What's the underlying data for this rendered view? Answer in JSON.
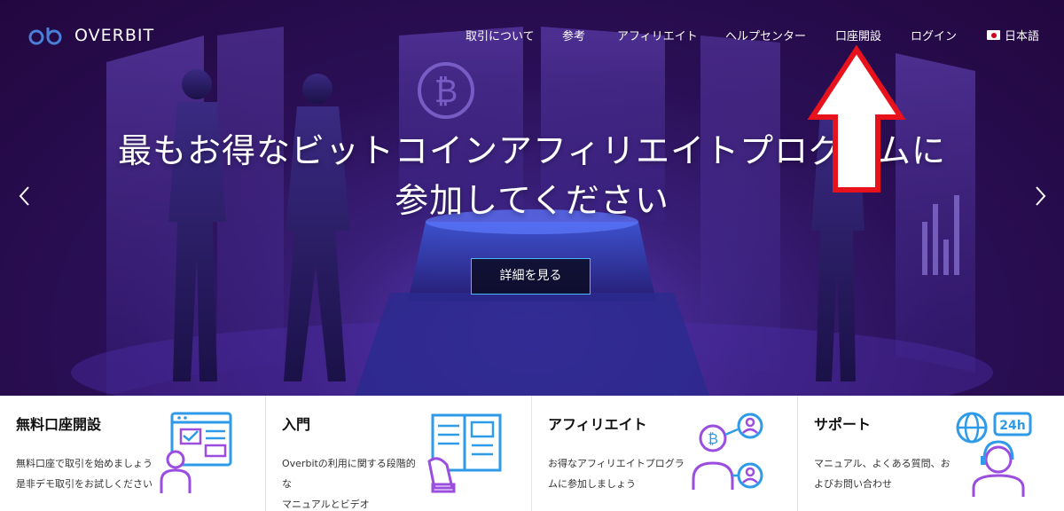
{
  "brand": {
    "name": "OVERBIT",
    "mark": "ob"
  },
  "nav": {
    "items": [
      "取引について",
      "参考",
      "アフィリエイト",
      "ヘルプセンター",
      "口座開設",
      "ログイン"
    ],
    "language": "日本語"
  },
  "hero": {
    "headline_line1": "最もお得なビットコインアフィリエイトプログラムに",
    "headline_line2": "参加してください",
    "cta_label": "詳細を見る"
  },
  "cards": [
    {
      "title": "無料口座開設",
      "desc_line1": "無料口座で取引を始めましょう",
      "desc_line2": "是非デモ取引をお試しください",
      "icon": "account-signup-icon"
    },
    {
      "title": "入門",
      "desc_line1": "Overbitの利用に関する段階的な",
      "desc_line2": "マニュアルとビデオ",
      "icon": "manual-book-icon"
    },
    {
      "title": "アフィリエイト",
      "desc_line1": "お得なアフィリエイトプログラ",
      "desc_line2": "ムに参加しましょう",
      "icon": "affiliate-network-icon"
    },
    {
      "title": "サポート",
      "desc_line1": "マニュアル、よくある質問、お",
      "desc_line2": "よびお問い合わせ",
      "icon": "support-24h-icon"
    }
  ],
  "colors": {
    "hero_bg": "#2a0f56",
    "cta_border": "#4ab6ff",
    "icon_blue": "#2f9be8",
    "icon_purple": "#9b4de0",
    "arrow_red": "#e8121c",
    "logo_blue": "#4a7fd8"
  }
}
